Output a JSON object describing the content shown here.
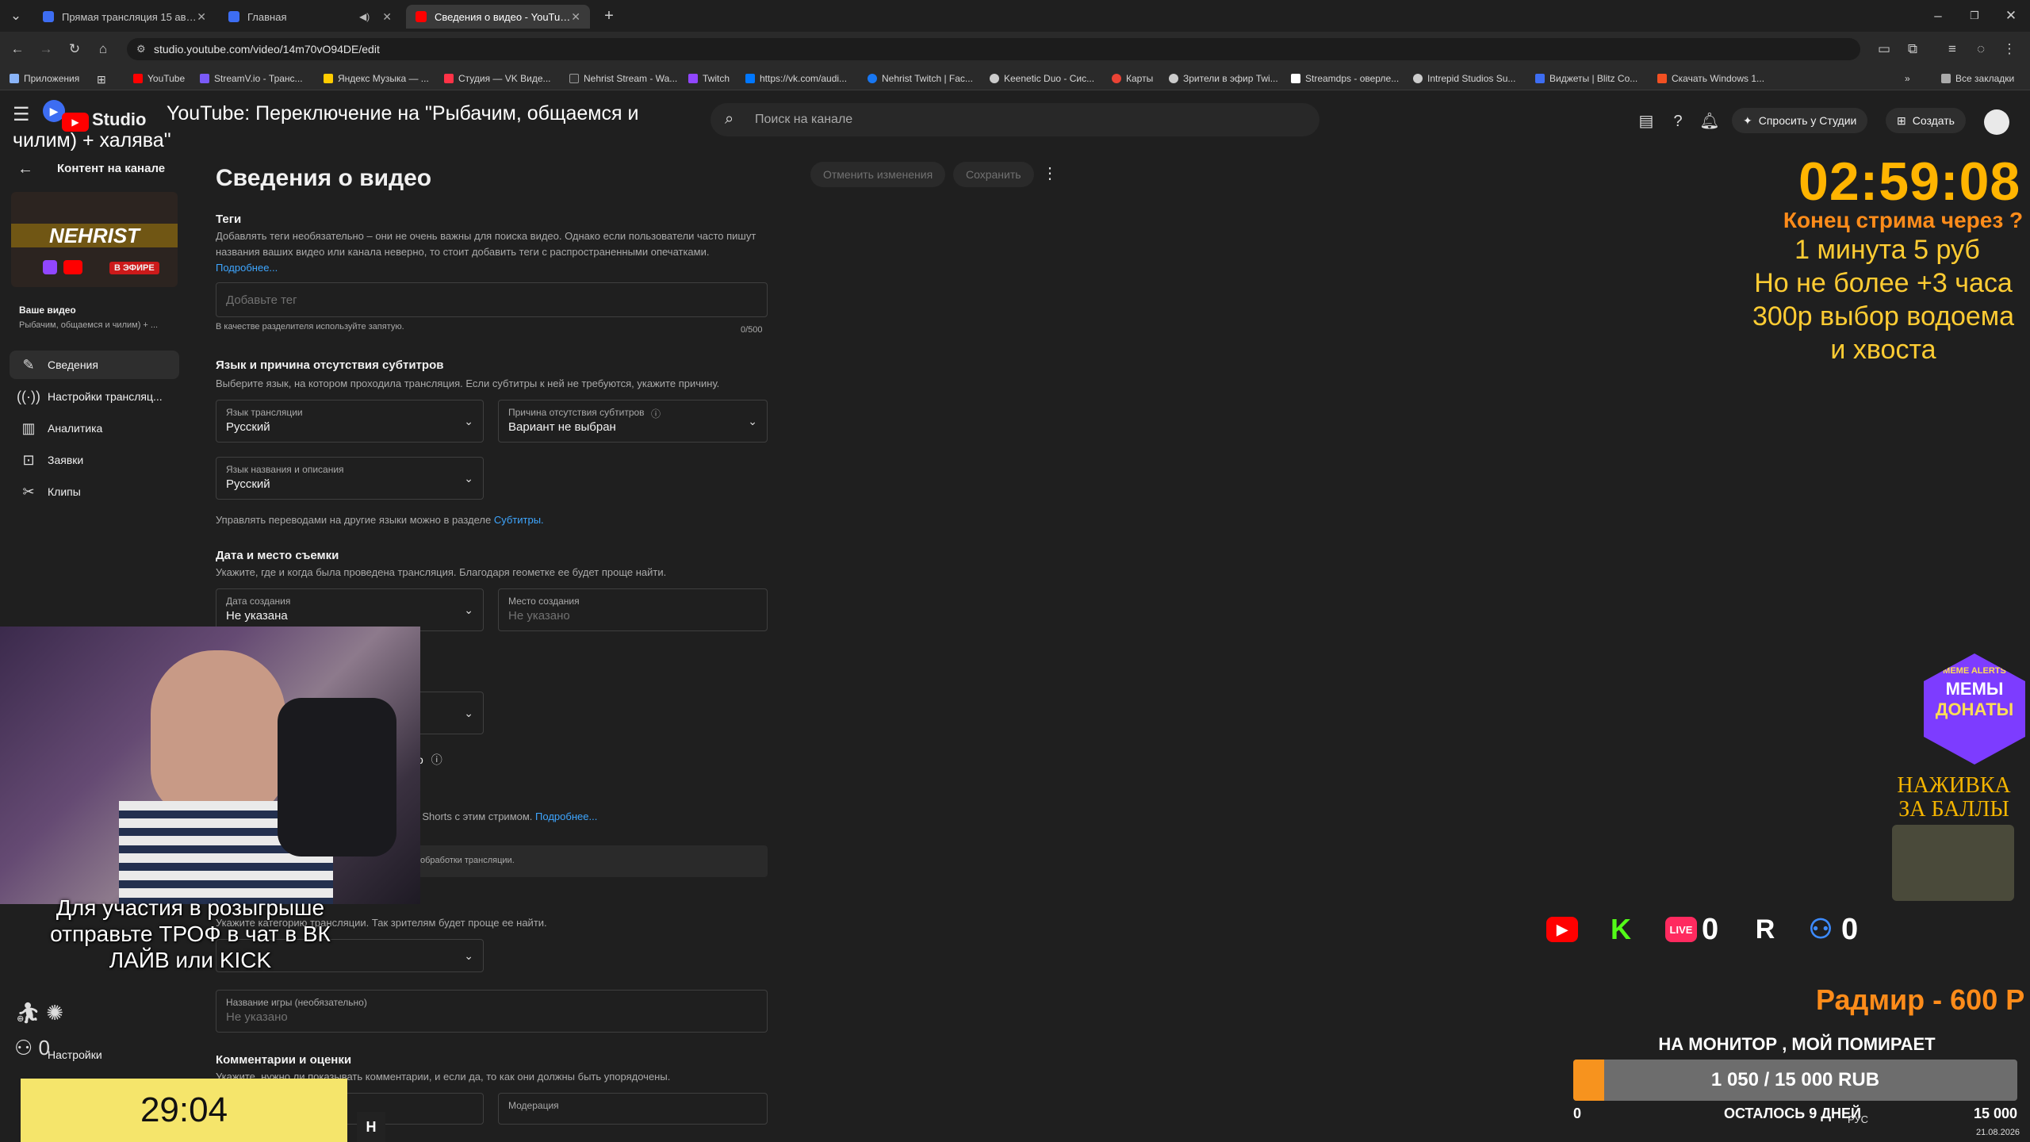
{
  "browser": {
    "tabs": [
      {
        "label": "Прямая трансляция 15 августа",
        "color": "#3d6df2"
      },
      {
        "label": "Главная",
        "color": "#3d6df2"
      },
      {
        "label": "Сведения о видео - YouTube Studio",
        "color": "#ff0000"
      }
    ],
    "url": "studio.youtube.com/video/14m70vO94DE/edit",
    "bookmarks": [
      "Приложения",
      "YouTube",
      "StreamV.io - Транс...",
      "Яндекс Музыка — ...",
      "Студия — VK Виде...",
      "Nehrist Stream - Wa...",
      "Twitch",
      "https://vk.com/audi...",
      "Nehrist Twitch | Fac...",
      "Keenetic Duo - Сис...",
      "Карты",
      "Зрители в эфир Twi...",
      "Streamdps - оверле...",
      "Intrepid Studios Su...",
      "Виджеты | Blitz Co...",
      "Скачать Windows 1..."
    ],
    "all_bookmarks": "Все закладки"
  },
  "header": {
    "search_placeholder": "Поиск на канале",
    "ask_studio": "Спросить у Студии",
    "create": "Создать"
  },
  "sidebar": {
    "back_label": "Контент на канале",
    "channel_name": "NEHRIST",
    "live_badge": "В ЭФИРЕ",
    "your_video": "Ваше видео",
    "video_title_short": "Рыбачим, общаемся и чилим) + ...",
    "items": [
      {
        "label": "Сведения",
        "icon": "pencil-icon"
      },
      {
        "label": "Настройки трансляц...",
        "icon": "broadcast-icon"
      },
      {
        "label": "Аналитика",
        "icon": "analytics-icon"
      },
      {
        "label": "Заявки",
        "icon": "requests-icon"
      },
      {
        "label": "Клипы",
        "icon": "scissors-icon"
      }
    ],
    "settings": "Настройки"
  },
  "main": {
    "title": "Сведения о видео",
    "undo": "Отменить изменения",
    "save": "Сохранить",
    "tags": {
      "title": "Теги",
      "desc": "Добавлять теги необязательно – они не очень важны для поиска видео. Однако если пользователи часто пишут названия ваших видео или канала неверно, то стоит добавить теги с распространенными опечатками.",
      "more": "Подробнее...",
      "placeholder": "Добавьте тег",
      "hint": "В качестве разделителя используйте запятую.",
      "counter": "0/500"
    },
    "language": {
      "title": "Язык и причина отсутствия субтитров",
      "desc": "Выберите язык, на котором проходила трансляция. Если субтитры к ней не требуются, укажите причину.",
      "broadcast_lang_label": "Язык трансляции",
      "broadcast_lang_value": "Русский",
      "no_subs_label": "Причина отсутствия субтитров",
      "no_subs_value": "Вариант не выбран",
      "title_lang_label": "Язык названия и описания",
      "title_lang_value": "Русский",
      "translations_note": "Управлять переводами на другие языки можно в разделе",
      "subtitles_link": "Субтитры."
    },
    "date_place": {
      "title": "Дата и место съемки",
      "desc": "Укажите, где и когда была проведена трансляция. Благодаря геометке ее будет проще найти.",
      "date_label": "Дата создания",
      "date_value": "Не указана",
      "place_label": "Место создания",
      "place_value": "Не указано"
    },
    "partial": {
      "license_value_tail": "ube",
      "embed_tail": "о",
      "shorts_text": "ть Shorts с этим стримом.",
      "shorts_more": "Подробнее...",
      "processing": "обработки трансляции.",
      "category_desc": "Укажите категорию трансляции. Так зрителям будет проще ее найти."
    },
    "game": {
      "label": "Название игры (необязательно)",
      "value": "Не указано"
    },
    "comments": {
      "title": "Комментарии и оценки",
      "desc": "Укажите, нужно ли показывать комментарии, и если да, то как они должны быть упорядочены.",
      "moderation_label": "Модерация"
    }
  },
  "overlay": {
    "title_line1": "YouTube: Переключение на \"Рыбачим, общаемся и",
    "title_line2": "чилим) + халява\"",
    "studio_logo_text": "Studio",
    "countdown": "02:59:08",
    "end_stream": "Конец стрима через ?",
    "rule1": "1 минута 5 руб",
    "rule2": "Но не более +3 часа",
    "rule3": "300р выбор водоема",
    "rule4": "и хвоста",
    "memes_badge_line1": "МЕМЫ",
    "memes_badge_line2": "ДОНАТЫ",
    "memes_badge_top": "MEME ALERTS",
    "bait_line1": "НАЖИВКА",
    "bait_line2": "ЗА БАЛЛЫ",
    "platforms": [
      {
        "name": "youtube-logo",
        "count": ""
      },
      {
        "name": "kick-logo",
        "count": ""
      },
      {
        "name": "vklive-logo",
        "count": "0"
      },
      {
        "name": "rutube-logo",
        "count": ""
      },
      {
        "name": "viewers-icon",
        "count": "0"
      }
    ],
    "donation": "Радмир - 600 Р",
    "donation_msg": "НА МОНИТОР , МОЙ ПОМИРАЕТ",
    "goal_text": "1 050 / 15 000 RUB",
    "goal_progress": 0.07,
    "goal_min": "0",
    "goal_days": "ОСТАЛОСЬ 9 ДНЕЙ",
    "goal_max": "15 000",
    "cam_caption": "Для участия в розыгрыше отправьте ТРОФ в чат в ВК ЛАЙВ или KICK",
    "small_counter_a": "",
    "small_counter_b": "0",
    "timer_small": "29:04",
    "taskbar_lang": "РУС",
    "taskbar_date": "21.08.2026"
  }
}
